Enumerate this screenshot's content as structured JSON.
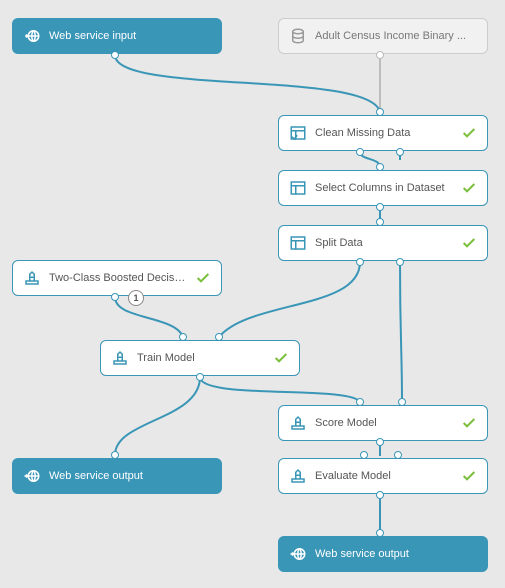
{
  "nodes": {
    "ws_input": {
      "label": "Web service input"
    },
    "dataset": {
      "label": "Adult Census Income Binary ..."
    },
    "clean": {
      "label": "Clean Missing Data"
    },
    "select": {
      "label": "Select Columns in Dataset"
    },
    "split": {
      "label": "Split Data"
    },
    "boosted": {
      "label": "Two-Class Boosted Decision ...",
      "badge": "1"
    },
    "train": {
      "label": "Train Model"
    },
    "score": {
      "label": "Score Model"
    },
    "evaluate": {
      "label": "Evaluate Model"
    },
    "ws_out1": {
      "label": "Web service output"
    },
    "ws_out2": {
      "label": "Web service output"
    }
  },
  "colors": {
    "teal": "#3a96b7",
    "check": "#7bbf3b",
    "gray_wire": "#bdbdbd",
    "bg": "#e8e8e8"
  }
}
